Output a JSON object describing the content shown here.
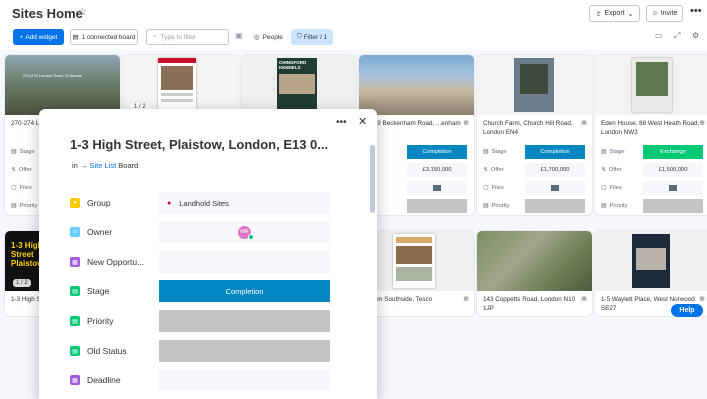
{
  "header": {
    "title": "Sites Home",
    "export_label": "Export",
    "invite_label": "Invite"
  },
  "toolbar": {
    "add_widget": "Add widget",
    "connected_board": "1 connected board",
    "filter_placeholder": "Type to filter",
    "people": "People",
    "filter": "Filter / 1"
  },
  "cards_top": [
    {
      "addr": "270-274 L... Albans",
      "image_text": "270-274 London Road, St Albans",
      "pager": "",
      "stage": "",
      "offer": "",
      "files": "",
      "priority": ""
    },
    {
      "addr": "",
      "image_text": "",
      "pager": "1 / 2",
      "stage": "",
      "offer": "",
      "files": "",
      "priority": ""
    },
    {
      "addr": "",
      "image_text": "CHINGFORD KENNELS",
      "pager": "",
      "stage": "",
      "offer": "",
      "files": "",
      "priority": ""
    },
    {
      "addr": "...249 Beckenham Road, ...enham",
      "stage": "Completion",
      "offer": "£3,150,000"
    },
    {
      "addr": "Church Farm, Church Hill Road, London EN4",
      "stage": "Completion",
      "offer": "£1,700,000"
    },
    {
      "addr": "Eden House, 88 West Heath Road, London NW3",
      "stage": "Exchange",
      "offer": "£1,500,000"
    }
  ],
  "cards_bottom": [
    {
      "addr": "1-3 High S... London, E...",
      "image_text": "1-3 High Street Plaistow",
      "pager": "1 / 2"
    },
    {
      "addr": ""
    },
    {
      "addr": ""
    },
    {
      "addr": "...ham Southside, Tesco"
    },
    {
      "addr": "143 Coppetts Road, London N10 1JP"
    },
    {
      "addr": "1-5 Waylett Place, West Norwood SE27"
    }
  ],
  "card_labels": {
    "stage": "Stage",
    "offer": "Offer",
    "files": "Files",
    "priority": "Priority"
  },
  "popup": {
    "title": "1-3 High Street, Plaistow, London, E13 0...",
    "in_prefix": "in →",
    "board_link": "Site List",
    "board_suffix": "Board",
    "rows": [
      {
        "name": "Group",
        "value": "Landhold Sites",
        "color": "#ffcb00"
      },
      {
        "name": "Owner",
        "value": "MR",
        "color": "#66ccff"
      },
      {
        "name": "New Opportu...",
        "value": "",
        "color": "#a25ddc"
      },
      {
        "name": "Stage",
        "value": "Completion",
        "color": "#00c875"
      },
      {
        "name": "Priority",
        "value": "",
        "color": "#00c875"
      },
      {
        "name": "Old Status",
        "value": "",
        "color": "#00c875"
      },
      {
        "name": "Deadline",
        "value": "",
        "color": "#a25ddc"
      }
    ]
  },
  "help_label": "Help"
}
